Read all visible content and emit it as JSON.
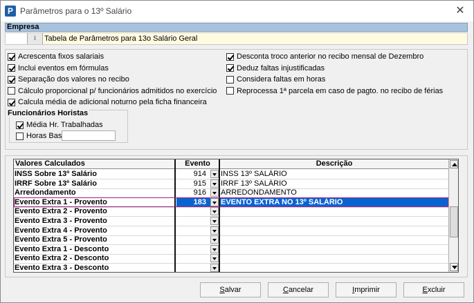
{
  "window": {
    "title": "Parâmetros para o 13º Salário",
    "app_letter": "P"
  },
  "empresa": {
    "header": "Empresa",
    "code": "",
    "name": "Tabela de Parâmetros para 13o Salário Geral"
  },
  "options_left": [
    {
      "label": "Acrescenta fixos salariais",
      "checked": true
    },
    {
      "label": "Inclui eventos em fórmulas",
      "checked": true
    },
    {
      "label": "Separação dos valores no recibo",
      "checked": true
    },
    {
      "label": "Cálculo proporcional p/ funcionários admitidos no exercício",
      "checked": false
    },
    {
      "label": "Calcula média de adicional noturno pela ficha financeira",
      "checked": true
    }
  ],
  "options_right": [
    {
      "label": "Desconta troco anterior no recibo mensal de Dezembro",
      "checked": true
    },
    {
      "label": "Deduz faltas injustificadas",
      "checked": true
    },
    {
      "label": "Considera faltas em horas",
      "checked": false
    },
    {
      "label": "Reprocessa 1ª parcela em caso de pagto. no recibo de férias",
      "checked": false
    }
  ],
  "horistas": {
    "title": "Funcionários Horistas",
    "media": {
      "label": "Média Hr. Trabalhadas",
      "checked": true
    },
    "horas": {
      "label": "Horas Base",
      "checked": false,
      "value": ""
    }
  },
  "grid": {
    "headers": {
      "nome": "Valores Calculados",
      "evento": "Evento",
      "descricao": "Descrição"
    },
    "rows": [
      {
        "nome": "INSS Sobre 13º Salário",
        "evento": "914",
        "descricao": "INSS 13º SALÁRIO"
      },
      {
        "nome": "IRRF Sobre 13º Salário",
        "evento": "915",
        "descricao": "IRRF 13º SALÁRIO"
      },
      {
        "nome": "Arredondamento",
        "evento": "916",
        "descricao": "ARREDONDAMENTO"
      },
      {
        "nome": "Evento Extra 1 - Provento",
        "evento": "183",
        "descricao": "EVENTO EXTRA NO 13º SALÁRIO",
        "selected": true
      },
      {
        "nome": "Evento Extra 2 - Provento",
        "evento": "",
        "descricao": ""
      },
      {
        "nome": "Evento Extra 3 - Provento",
        "evento": "",
        "descricao": ""
      },
      {
        "nome": "Evento Extra 4 - Provento",
        "evento": "",
        "descricao": ""
      },
      {
        "nome": "Evento Extra 5 - Provento",
        "evento": "",
        "descricao": ""
      },
      {
        "nome": "Evento Extra 1 - Desconto",
        "evento": "",
        "descricao": ""
      },
      {
        "nome": "Evento Extra 2 - Desconto",
        "evento": "",
        "descricao": ""
      },
      {
        "nome": "Evento Extra 3 - Desconto",
        "evento": "",
        "descricao": ""
      }
    ]
  },
  "buttons": {
    "salvar": {
      "accel": "S",
      "rest": "alvar"
    },
    "cancelar": {
      "accel": "C",
      "rest": "ancelar"
    },
    "imprimir": {
      "accel": "I",
      "rest": "mprimir"
    },
    "excluir": {
      "accel": "E",
      "rest": "xcluir"
    }
  },
  "colors": {
    "selection": "#0a64d0",
    "empresa_bar": "#a9c3df",
    "empresa_row": "#fffbe0"
  }
}
